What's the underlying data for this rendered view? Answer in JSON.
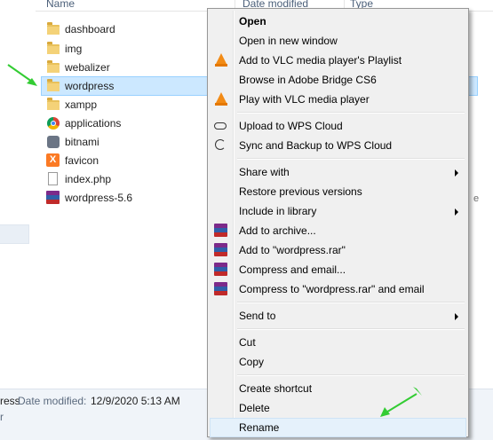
{
  "columns": {
    "name": "Name",
    "date_modified": "Date modified",
    "type": "Type"
  },
  "files": [
    {
      "name": "dashboard",
      "icon": "folder-icon",
      "selected": false
    },
    {
      "name": "img",
      "icon": "folder-icon",
      "selected": false
    },
    {
      "name": "webalizer",
      "icon": "folder-icon",
      "selected": false
    },
    {
      "name": "wordpress",
      "icon": "folder-icon",
      "selected": true
    },
    {
      "name": "xampp",
      "icon": "folder-icon",
      "selected": false
    },
    {
      "name": "applications",
      "icon": "chrome-icon",
      "selected": false
    },
    {
      "name": "bitnami",
      "icon": "bitnami-icon",
      "selected": false
    },
    {
      "name": "favicon",
      "icon": "xampp-icon",
      "selected": false
    },
    {
      "name": "index.php",
      "icon": "document-icon",
      "selected": false
    },
    {
      "name": "wordpress-5.6",
      "icon": "winrar-icon",
      "selected": false
    }
  ],
  "details": {
    "name_partial": "ress",
    "date_label": "Date modified:",
    "date_value": "12/9/2020 5:13 AM",
    "second_line_partial": "r"
  },
  "context_menu": {
    "items": [
      {
        "label": "Open",
        "bold": true
      },
      {
        "label": "Open in new window"
      },
      {
        "label": "Add to VLC media player's Playlist",
        "icon": "vlc-icon"
      },
      {
        "label": "Browse in Adobe Bridge CS6"
      },
      {
        "label": "Play with VLC media player",
        "icon": "vlc-icon"
      },
      {
        "label": "Upload to WPS Cloud",
        "icon": "cloud-icon"
      },
      {
        "label": "Sync and Backup to WPS Cloud",
        "icon": "sync-icon"
      },
      {
        "label": "Share with",
        "submenu": true
      },
      {
        "label": "Restore previous versions"
      },
      {
        "label": "Include in library",
        "submenu": true
      },
      {
        "label": "Add to archive...",
        "icon": "winrar-icon"
      },
      {
        "label": "Add to \"wordpress.rar\"",
        "icon": "winrar-icon"
      },
      {
        "label": "Compress and email...",
        "icon": "winrar-icon"
      },
      {
        "label": "Compress to \"wordpress.rar\" and email",
        "icon": "winrar-icon"
      },
      {
        "label": "Send to",
        "submenu": true
      },
      {
        "label": "Cut"
      },
      {
        "label": "Copy"
      },
      {
        "label": "Create shortcut"
      },
      {
        "label": "Delete"
      },
      {
        "label": "Rename",
        "highlighted": true
      }
    ]
  },
  "colors": {
    "selection": "#cce8ff",
    "menu_bg": "#f0f0f0",
    "menu_hover": "#e5f1fb",
    "annotation_arrow": "#33cc33"
  }
}
